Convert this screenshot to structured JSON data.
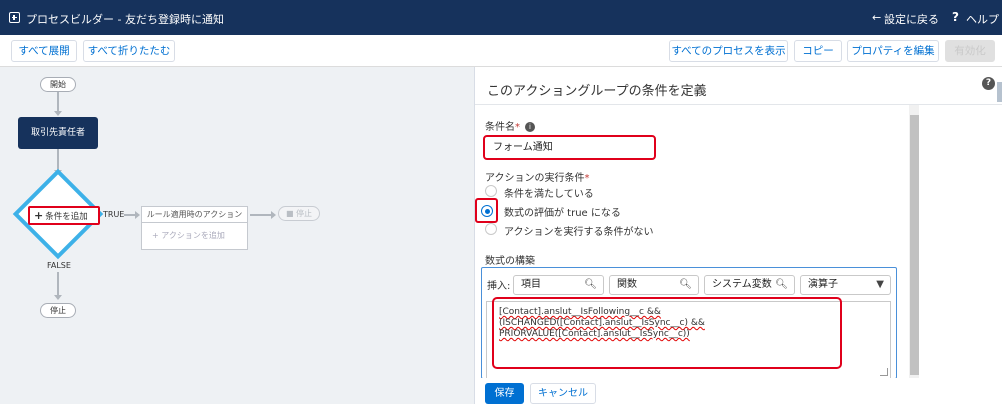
{
  "header": {
    "title": "プロセスビルダー - 友だち登録時に通知",
    "back_label": "設定に戻る",
    "help_label": "ヘルプ"
  },
  "toolbar": {
    "expand_all": "すべて展開",
    "collapse_all": "すべて折りたたむ",
    "view_all_processes": "すべてのプロセスを表示",
    "copy": "コピー",
    "edit_properties": "プロパティを編集",
    "activate": "有効化"
  },
  "canvas": {
    "start_label": "開始",
    "object_node": "取引先責任者",
    "criteria_add": "条件を追加",
    "true_label": "TRUE",
    "false_label": "FALSE",
    "action_group_header": "ルール適用時のアクション",
    "add_action": "アクションを追加",
    "stop_label": "停止"
  },
  "panel": {
    "title": "このアクショングループの条件を定義",
    "criteria_name_label": "条件名",
    "criteria_name_value": "フォーム通知",
    "exec_condition_label": "アクションの実行条件",
    "options": [
      {
        "label": "条件を満たしている",
        "selected": false
      },
      {
        "label": "数式の評価が true になる",
        "selected": true
      },
      {
        "label": "アクションを実行する条件がない",
        "selected": false
      }
    ],
    "formula_section_label": "数式の構築",
    "insert_label": "挿入:",
    "insert_field": "項目",
    "insert_function": "関数",
    "insert_system_var": "システム変数",
    "insert_operator": "演算子",
    "formula_line1": "[Contact].anslut__IsFollowing__c && (ISCHANGED([Contact].anslut__IsSync__c) &&",
    "formula_line2": "PRIORVALUE([Contact].anslut__IsSync__c))",
    "save_label": "保存",
    "cancel_label": "キャンセル"
  },
  "colors": {
    "header_bg": "#16325c",
    "accent_blue": "#0070d2",
    "diamond_border": "#3db1e8",
    "highlight_red": "#e0001b"
  }
}
